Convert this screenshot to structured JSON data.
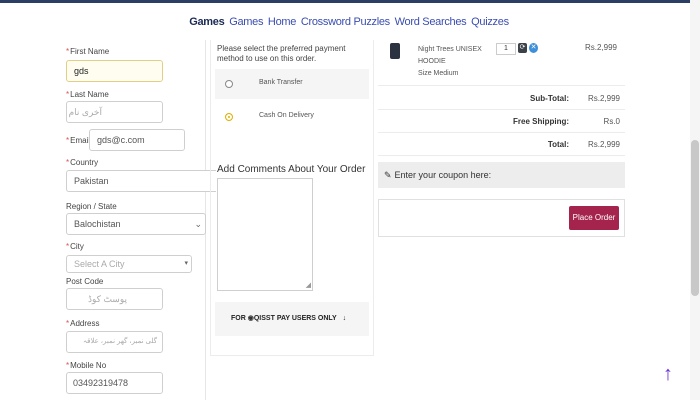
{
  "nav": {
    "brand": "Games",
    "links": [
      "Games",
      "Home",
      "Crossword Puzzles",
      "Word Searches",
      "Quizzes"
    ]
  },
  "form": {
    "first_name": {
      "label": "First Name",
      "value": "gds"
    },
    "last_name": {
      "label": "Last Name",
      "placeholder": "آخری نام"
    },
    "email": {
      "label": "Email",
      "value": "gds@c.com"
    },
    "country": {
      "label": "Country",
      "value": "Pakistan"
    },
    "region": {
      "label": "Region / State",
      "value": "Balochistan"
    },
    "city": {
      "label": "City",
      "placeholder": "Select A City"
    },
    "post_code": {
      "label": "Post Code",
      "placeholder": "پوسٹ کوڈ"
    },
    "address": {
      "label": "Address",
      "placeholder": "گلی نمبر، گھر نمبر، علاقہ"
    },
    "mobile": {
      "label": "Mobile No",
      "value": "03492319478"
    }
  },
  "payment": {
    "intro": "Please select the preferred payment method to use on this order.",
    "options": [
      {
        "label": "Bank Transfer",
        "selected": false
      },
      {
        "label": "Cash On Delivery",
        "selected": true
      }
    ],
    "comments_label": "Add Comments About Your Order",
    "qisst_prefix": "FOR",
    "qisst_brand": "QISST",
    "qisst_suffix": "PAY USERS ONLY"
  },
  "cart": {
    "product": {
      "name_line1": "Night Trees UNISEX",
      "name_line2": "HOODIE",
      "name_line3": "Size Medium",
      "qty": "1",
      "price": "Rs.2,999"
    },
    "subtotal_label": "Sub-Total:",
    "subtotal_value": "Rs.2,999",
    "shipping_label": "Free Shipping:",
    "shipping_value": "Rs.0",
    "total_label": "Total:",
    "total_value": "Rs.2,999"
  },
  "coupon": {
    "label": "Enter your coupon here:"
  },
  "place_order_label": "Place Order",
  "colors": {
    "accent": "#a5244d",
    "nav": "#2b3e63",
    "selected_radio": "#e0b000"
  }
}
